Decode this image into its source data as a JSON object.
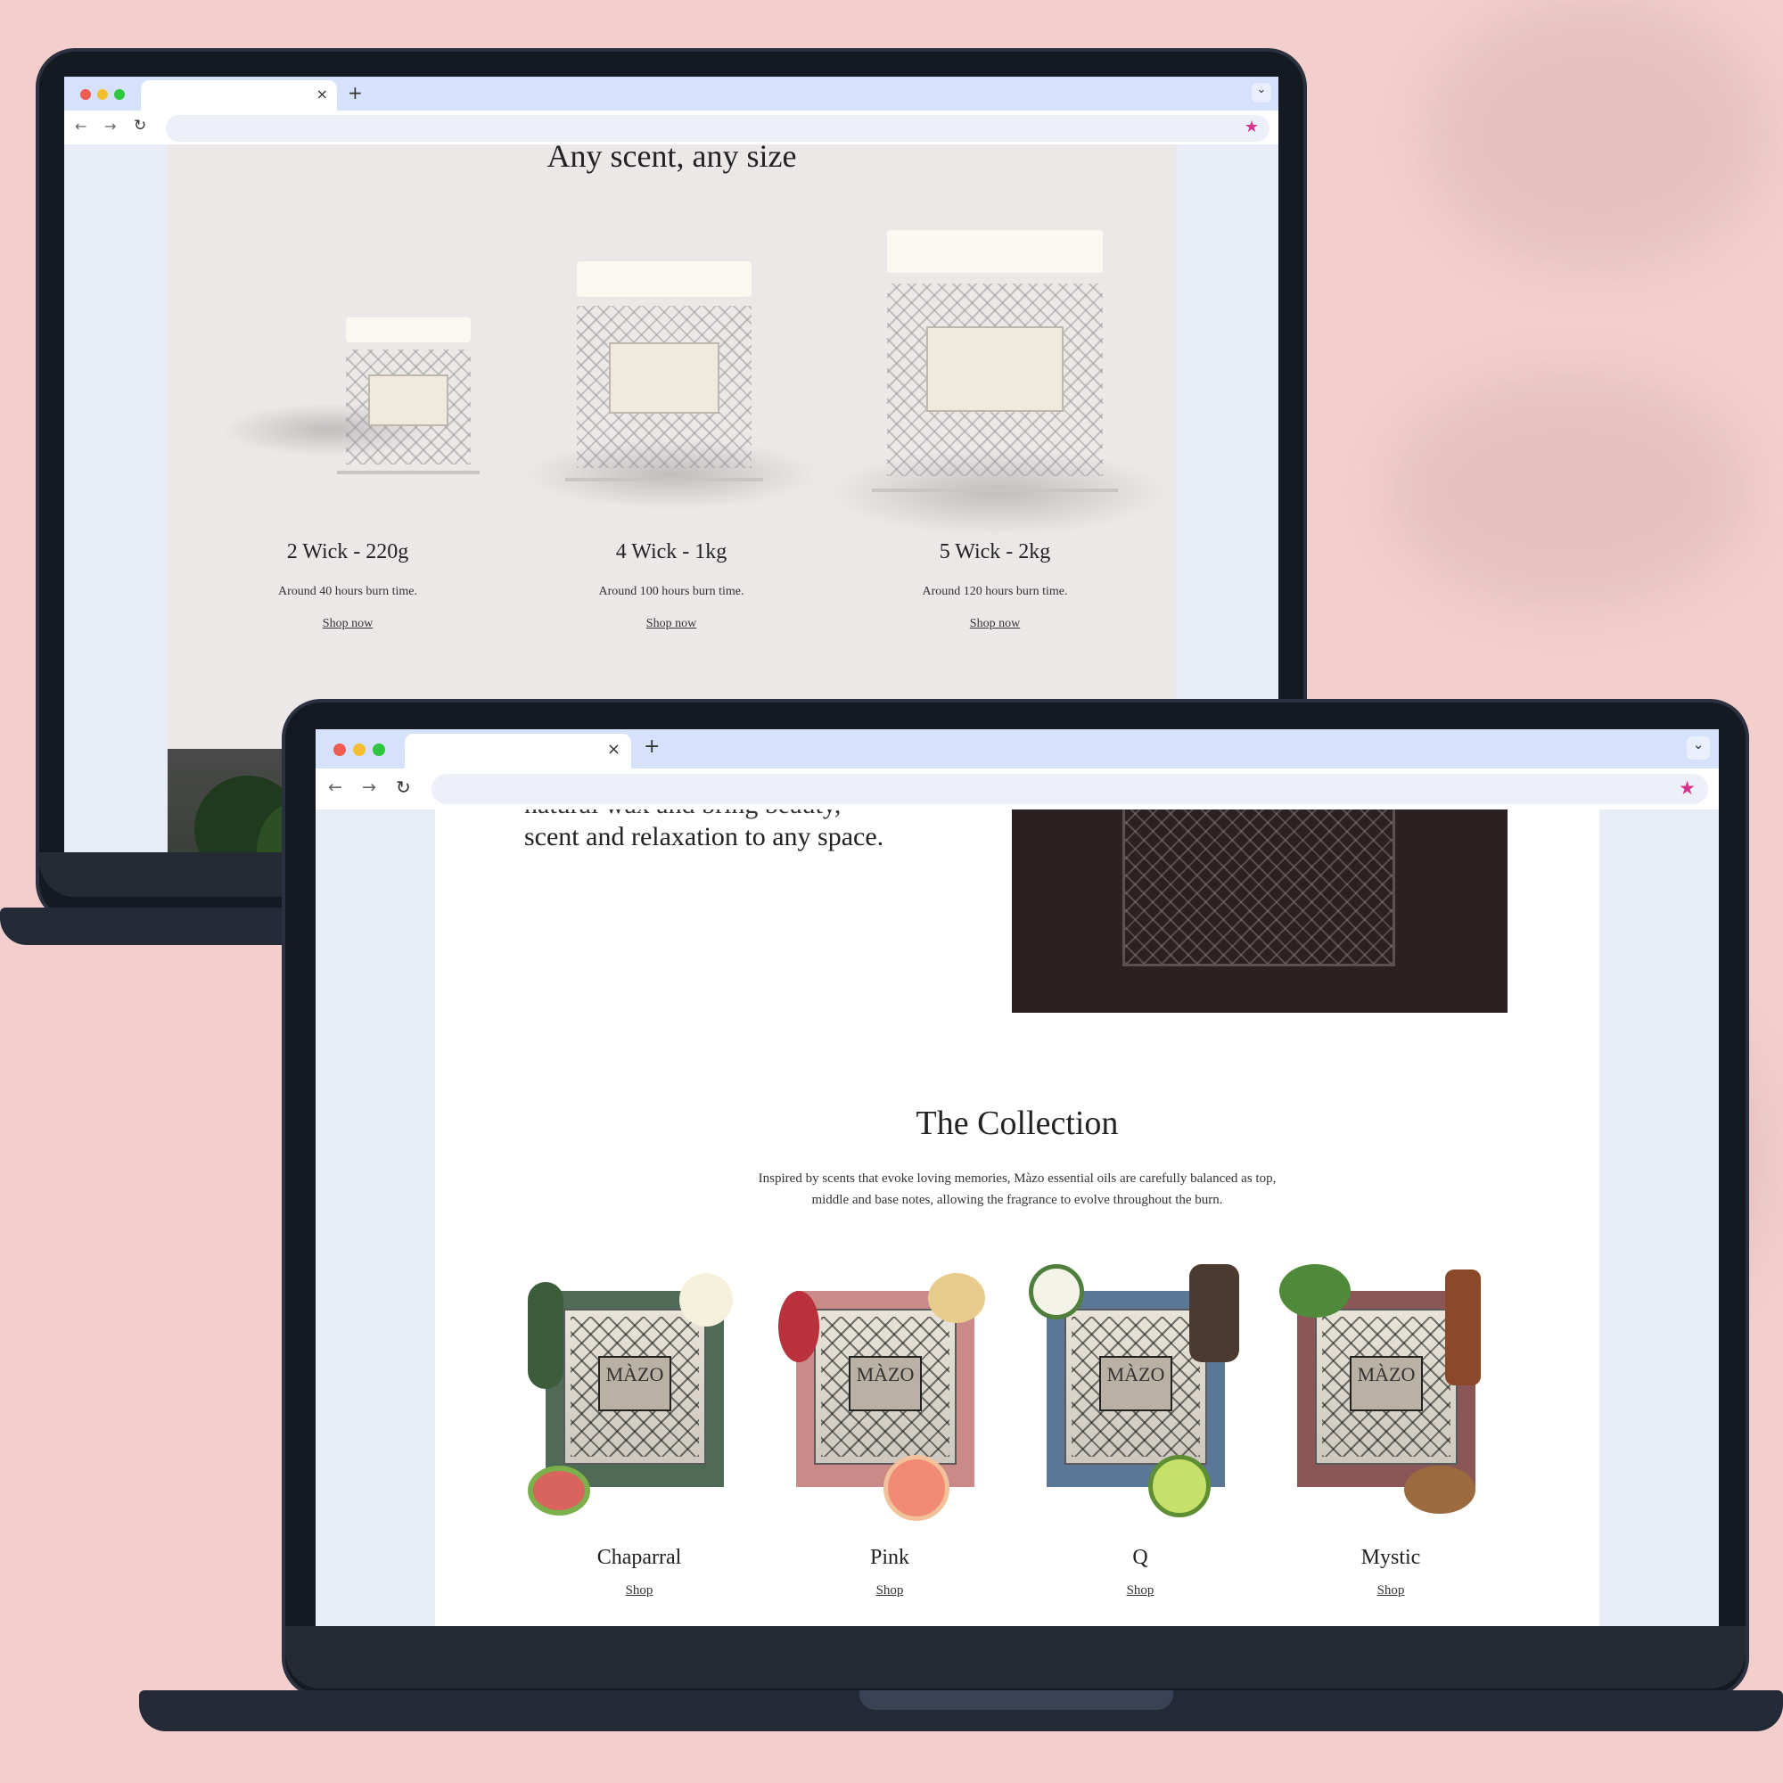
{
  "colors": {
    "background": "#f2cfcc",
    "accent_star": "#d6338f",
    "tab_bar": "#d6e2fb"
  },
  "back_laptop": {
    "page": {
      "heading": "Any scent, any size",
      "products": [
        {
          "name": "2 Wick - 220g",
          "desc": "Around 40 hours burn time.",
          "link": "Shop now"
        },
        {
          "name": "4 Wick - 1kg",
          "desc": "Around 100 hours burn time.",
          "link": "Shop now"
        },
        {
          "name": "5 Wick - 2kg",
          "desc": "Around 120 hours burn time.",
          "link": "Shop now"
        }
      ]
    }
  },
  "front_laptop": {
    "page": {
      "intro_partial": "natural wax and bring beauty,",
      "intro_line": "scent and relaxation to any space.",
      "collection_title": "The Collection",
      "collection_desc_1": "Inspired by scents that evoke loving memories, Màzo essential oils are carefully balanced as top,",
      "collection_desc_2": "middle and base notes, allowing the fragrance to evolve throughout the burn.",
      "brand_label": "MÀZO",
      "items": [
        {
          "name": "Chaparral",
          "link": "Shop",
          "color": "#4f6b58"
        },
        {
          "name": "Pink",
          "link": "Shop",
          "color": "#c98a88"
        },
        {
          "name": "Q",
          "link": "Shop",
          "color": "#5a7896"
        },
        {
          "name": "Mystic",
          "link": "Shop",
          "color": "#8a5656"
        }
      ]
    }
  },
  "browser": {
    "close_glyph": "×",
    "new_tab_glyph": "+",
    "menu_glyph": "⌄",
    "back_glyph": "←",
    "forward_glyph": "→",
    "reload_glyph": "↻",
    "star_glyph": "★"
  }
}
